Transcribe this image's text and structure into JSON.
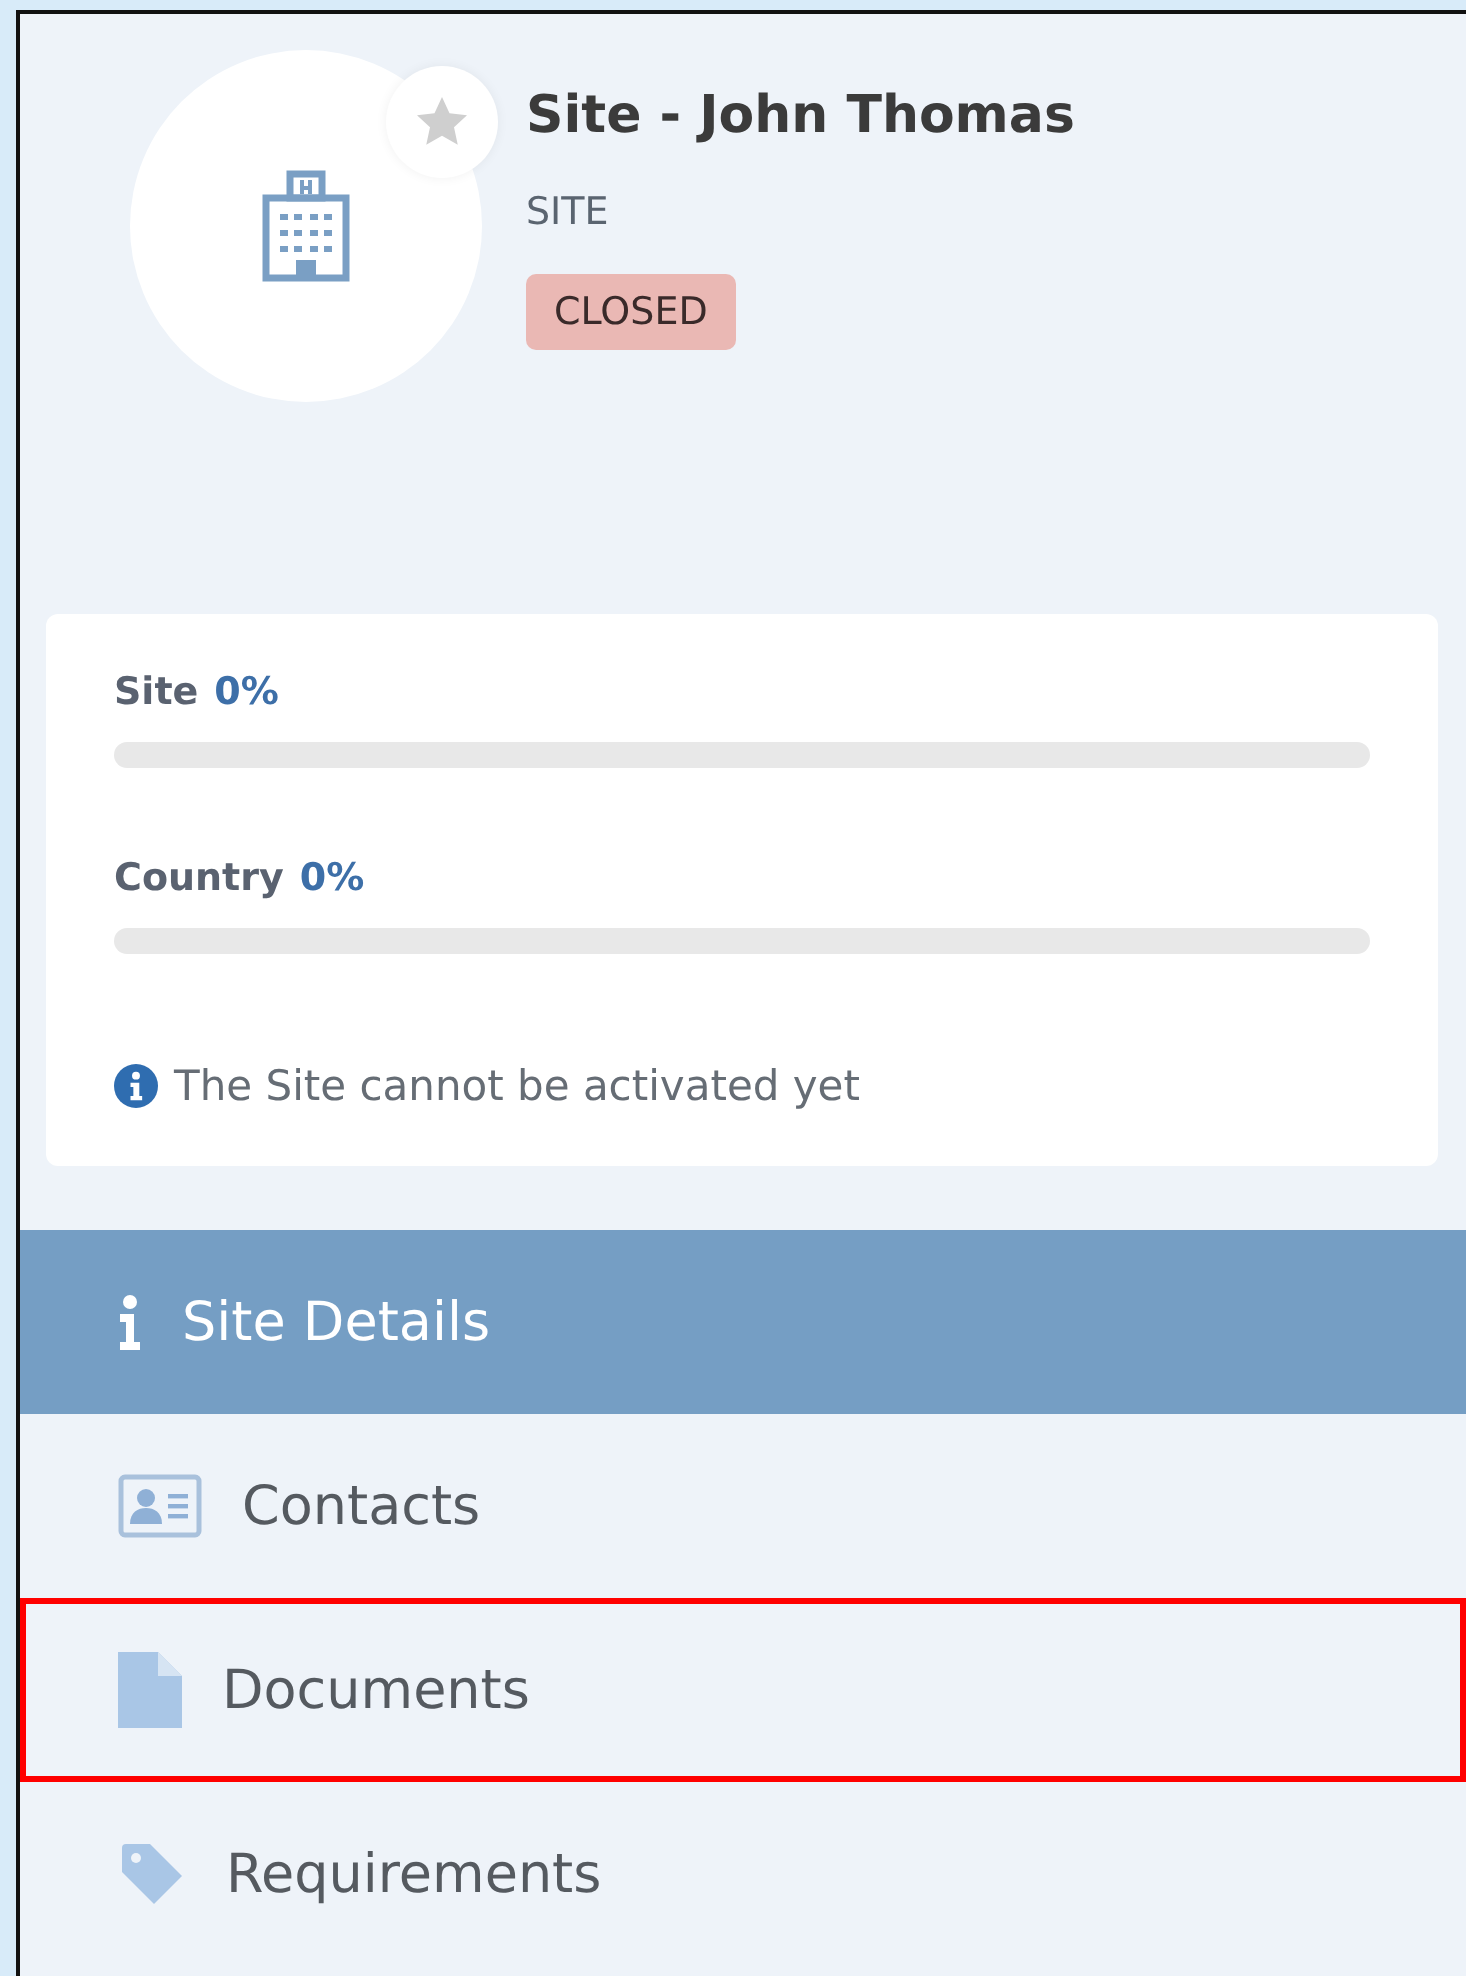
{
  "header": {
    "title": "Site - John Thomas",
    "subtitle": "SITE",
    "status": "CLOSED",
    "favorite": false
  },
  "progress": [
    {
      "label": "Site",
      "percent": "0%",
      "level": 0
    },
    {
      "label": "Country",
      "percent": "0%",
      "level": 0
    }
  ],
  "notice": "The Site cannot be activated yet",
  "nav": [
    {
      "label": "Site Details",
      "selected": true,
      "highlighted": false
    },
    {
      "label": "Contacts",
      "selected": false,
      "highlighted": false
    },
    {
      "label": "Documents",
      "selected": false,
      "highlighted": true
    },
    {
      "label": "Requirements",
      "selected": false,
      "highlighted": false
    }
  ]
}
